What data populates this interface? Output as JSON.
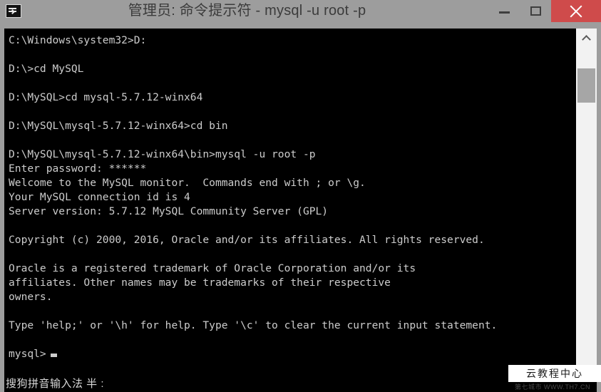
{
  "window": {
    "title": "管理员: 命令提示符 - mysql  -u root -p",
    "icon_name": "console-icon",
    "controls": {
      "minimize_label": "最小化",
      "maximize_label": "最大化",
      "close_label": "关闭"
    },
    "accent_close_color": "#cf4b4b",
    "titlebar_color": "#9d9d9d"
  },
  "console": {
    "background_color": "#000000",
    "text_color": "#cccccc",
    "prompt_value": "mysql>",
    "lines": [
      "C:\\Windows\\system32>D:",
      "",
      "D:\\>cd MySQL",
      "",
      "D:\\MySQL>cd mysql-5.7.12-winx64",
      "",
      "D:\\MySQL\\mysql-5.7.12-winx64>cd bin",
      "",
      "D:\\MySQL\\mysql-5.7.12-winx64\\bin>mysql -u root -p",
      "Enter password: ******",
      "Welcome to the MySQL monitor.  Commands end with ; or \\g.",
      "Your MySQL connection id is 4",
      "Server version: 5.7.12 MySQL Community Server (GPL)",
      "",
      "Copyright (c) 2000, 2016, Oracle and/or its affiliates. All rights reserved.",
      "",
      "Oracle is a registered trademark of Oracle Corporation and/or its",
      "affiliates. Other names may be trademarks of their respective",
      "owners.",
      "",
      "Type 'help;' or '\\h' for help. Type '\\c' to clear the current input statement.",
      "",
      "mysql>"
    ]
  },
  "scrollbar": {
    "up_arrow_name": "chevron-up-icon",
    "thumb_label": "scroll-thumb"
  },
  "ime": {
    "status_text": "搜狗拼音输入法 半 :"
  },
  "watermark": {
    "label": "云教程中心",
    "sub_label": "第七城市   WWW.TH7.CN"
  }
}
